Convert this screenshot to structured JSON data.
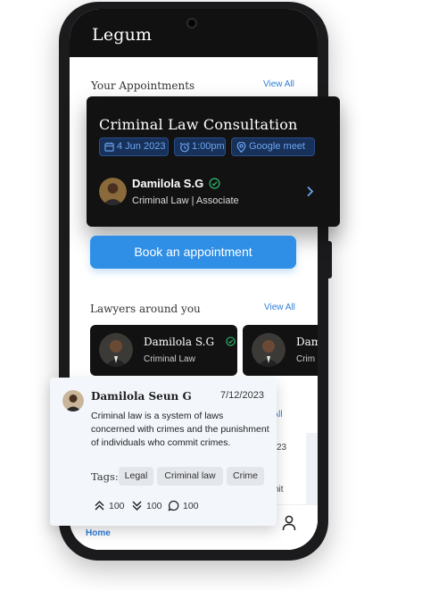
{
  "app": {
    "title": "Legum"
  },
  "appointments": {
    "section_title": "Your Appointments",
    "view_all": "View All"
  },
  "appointment_card": {
    "title": "Criminal Law Consultation",
    "date": "4 Jun 2023",
    "time": "1:00pm",
    "location": "Google meet",
    "lawyer_name": "Damilola S.G",
    "lawyer_role": "Criminal Law | Associate"
  },
  "book_button": "Book an appointment",
  "lawyers": {
    "section_title": "Lawyers around you",
    "view_all": "View All",
    "cards": [
      {
        "name": "Damilola S.G",
        "role": "Criminal Law"
      },
      {
        "name": "Dam",
        "role": "Crim"
      }
    ]
  },
  "hidden_section": {
    "view_all_fragment": "w All",
    "frag1": "23",
    "frag2": "nit"
  },
  "post": {
    "author": "Damilola Seun G",
    "date": "7/12/2023",
    "body": "Criminal law is a system of laws concerned with crimes and the punishment of individuals who commit crimes.",
    "tags_label": "Tags:",
    "tags": [
      "Legal",
      "Criminal law",
      "Crime"
    ],
    "upvotes": "100",
    "downvotes": "100",
    "comments": "100"
  },
  "bottom_nav": {
    "home": "Home"
  },
  "colors": {
    "accent": "#2f8fe6",
    "card_dark": "#121212",
    "chip_text": "#6ea6f0",
    "verified": "#2fb36a"
  }
}
